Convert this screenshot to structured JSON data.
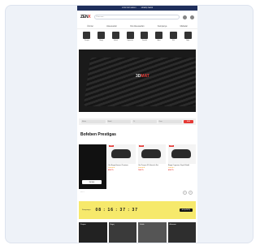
{
  "topbar": {
    "left": "ÜCRETSİZ KARGO",
    "right": "SİPARİŞ TAKİBİ"
  },
  "header": {
    "logo_main": "ZEN",
    "logo_accent": "X",
    "search_placeholder": "Ürün ara..."
  },
  "nav": [
    "Ürünler",
    "Aksesuarlar",
    "Oto Aksesuarları",
    "Kampanya",
    "Markalar"
  ],
  "categories": [
    {
      "label": "Paspas"
    },
    {
      "label": "Bagaj"
    },
    {
      "label": "Koltuk"
    },
    {
      "label": "Organizer"
    },
    {
      "label": "Temizlik"
    },
    {
      "label": "Ayna"
    },
    {
      "label": "Kılıf"
    },
    {
      "label": "Diğer"
    }
  ],
  "hero": {
    "badge_main": "3D",
    "badge_accent": "MAT"
  },
  "filter": {
    "f1": "Marka",
    "f2": "Model",
    "f3": "Yıl",
    "f4": "Kasa",
    "button": "ARA"
  },
  "section": {
    "title": "Bofeben Prestigas"
  },
  "promo": {
    "button": "İNCELE"
  },
  "products": [
    {
      "discount": "%20",
      "name": "Oto Bagaj Havuzu Premium",
      "price": "899 TL",
      "stars": "★★★★★"
    },
    {
      "discount": "%15",
      "name": "Oto Paspas 3D Havuzlu Set",
      "price": "749 TL",
      "stars": "★★★★★"
    },
    {
      "discount": "%10",
      "name": "Bagaj Organizer Siyah Model",
      "price": "499 TL",
      "stars": "★★★★☆"
    }
  ],
  "pager": {
    "text": "• • • •"
  },
  "countdown": {
    "label": "Kampanya",
    "time": "08 : 16 : 37 : 37",
    "button": "ALIŞVERİŞ"
  },
  "tiles": [
    {
      "label": "Paspas"
    },
    {
      "label": "Bagaj"
    },
    {
      "label": "Koltuk"
    },
    {
      "label": "Aksesuar"
    }
  ]
}
